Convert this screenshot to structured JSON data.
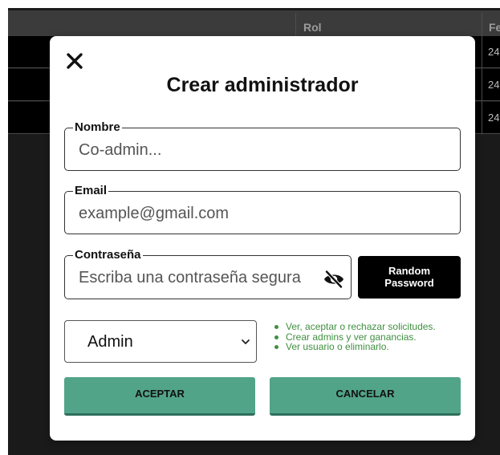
{
  "background_table": {
    "columns": [
      "Rol",
      "Fe"
    ],
    "rows": [
      {
        "date": "24"
      },
      {
        "date": "24"
      },
      {
        "date": "24"
      }
    ]
  },
  "modal": {
    "title": "Crear administrador",
    "close_icon": "close-icon",
    "fields": {
      "nombre": {
        "label": "Nombre",
        "placeholder": "Co-admin...",
        "value": ""
      },
      "email": {
        "label": "Email",
        "placeholder": "example@gmail.com",
        "value": ""
      },
      "password": {
        "label": "Contraseña",
        "placeholder": "Escriba una contraseña segura",
        "value": "",
        "toggle_icon": "eye-slash-icon"
      }
    },
    "random_button": {
      "line1": "Random",
      "line2": "Password"
    },
    "role_select": {
      "selected": "Admin",
      "icon": "chevron-down-icon"
    },
    "permissions": [
      "Ver, aceptar o rechazar solicitudes.",
      "Crear admins y ver ganancias.",
      "Ver usuario o eliminarlo."
    ],
    "accept_label": "ACEPTAR",
    "cancel_label": "CANCELAR"
  },
  "colors": {
    "accent": "#52a488",
    "permission_text": "#3f8f3f",
    "backdrop": "#161616"
  }
}
